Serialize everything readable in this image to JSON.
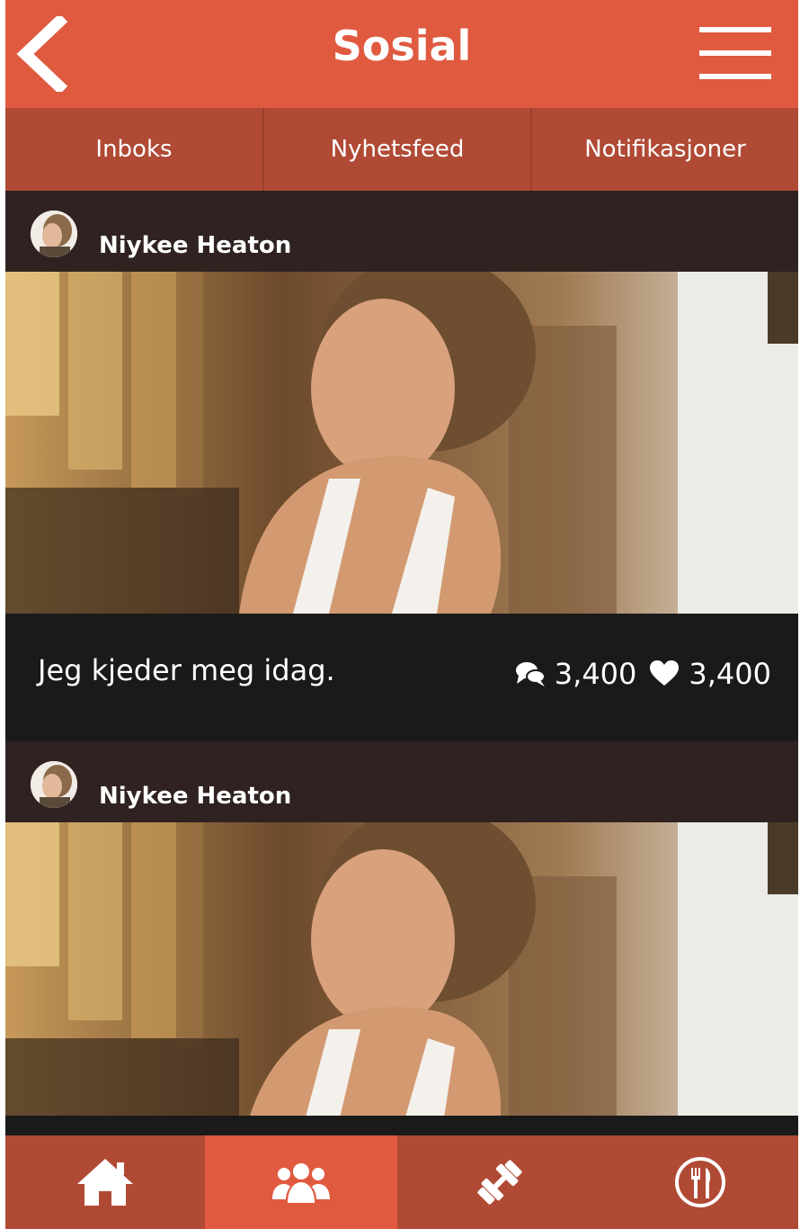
{
  "header": {
    "title": "Sosial",
    "back_icon": "chevron-left-icon",
    "menu_icon": "hamburger-menu-icon"
  },
  "tabs": [
    {
      "label": "Inboks"
    },
    {
      "label": "Nyhetsfeed"
    },
    {
      "label": "Notifikasjoner"
    }
  ],
  "feed": {
    "posts": [
      {
        "author": "Niykee Heaton",
        "caption": "Jeg kjeder meg idag.",
        "comments": "3,400",
        "likes": "3,400"
      },
      {
        "author": "Niykee Heaton"
      }
    ]
  },
  "bottom_nav": {
    "items": [
      {
        "icon": "home-icon",
        "active": false
      },
      {
        "icon": "group-icon",
        "active": true
      },
      {
        "icon": "dumbbell-icon",
        "active": false
      },
      {
        "icon": "fork-knife-icon",
        "active": false
      }
    ]
  },
  "colors": {
    "accent": "#e05a40",
    "accent_dark": "#b04a35",
    "post_header": "#2f2221",
    "background": "#1a1a1a"
  }
}
